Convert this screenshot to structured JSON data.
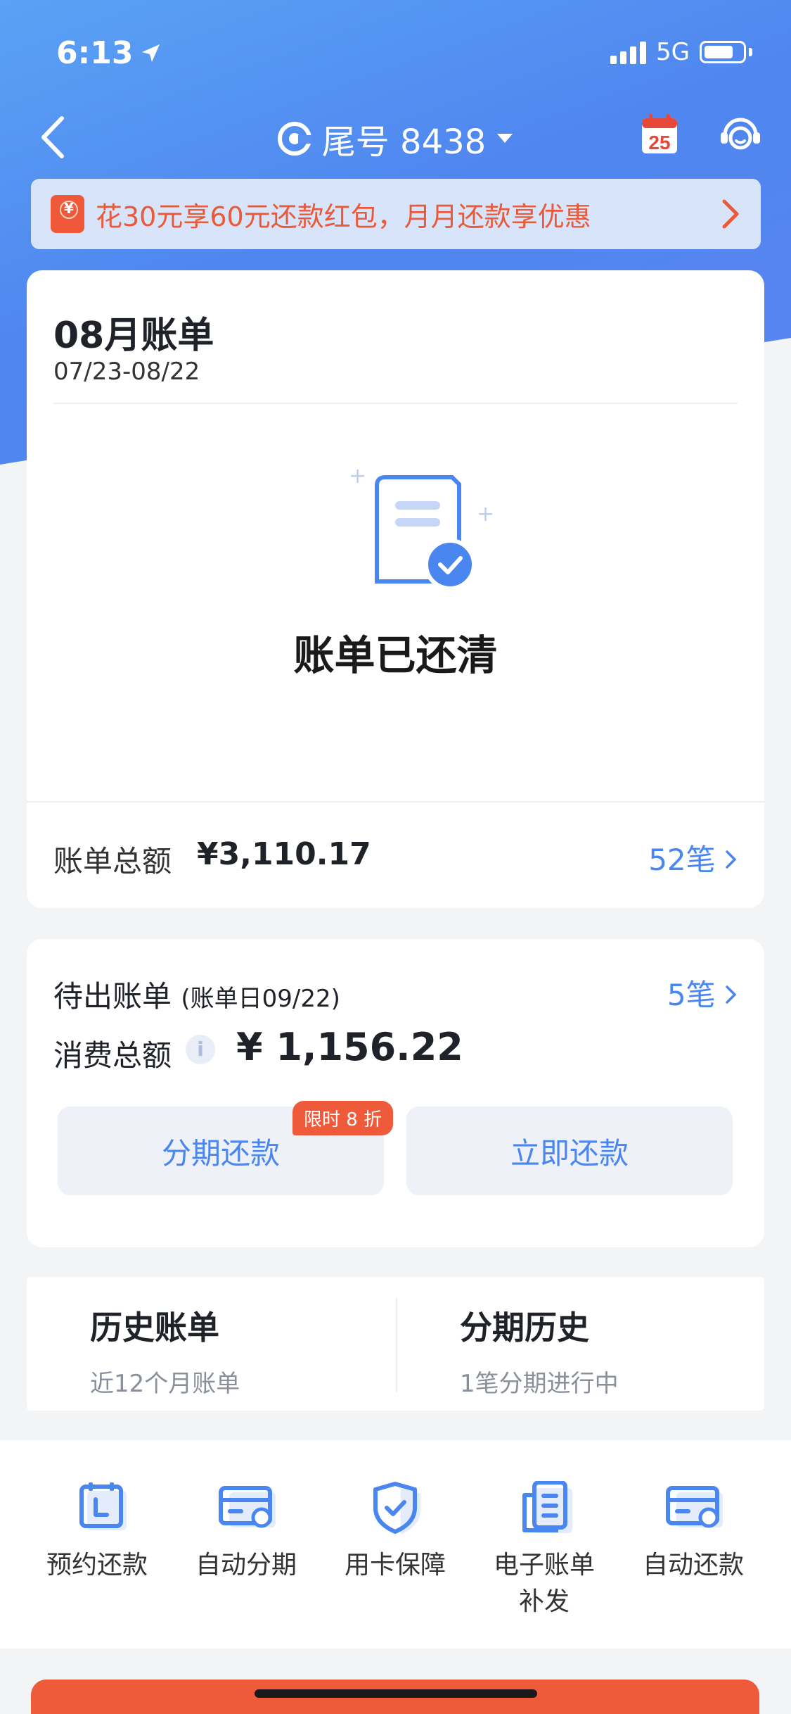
{
  "colors": {
    "accent": "#4a86f0",
    "promo": "#ea5a3a",
    "hero": "#4f86ef",
    "tag": "#ee5a3a"
  },
  "status_bar": {
    "time": "6:13",
    "network": "5G"
  },
  "nav": {
    "account_label": "尾号 8438",
    "calendar_day": "25",
    "icons": [
      "back-icon",
      "bank-logo-icon",
      "calendar-icon",
      "customer-service-icon"
    ]
  },
  "promo": {
    "text": "花30元享60元还款红包，月月还款享优惠"
  },
  "bill": {
    "title": "08月账单",
    "range": "07/23-08/22",
    "status": "账单已还清",
    "total_label": "账单总额",
    "total_value": "¥3,110.17",
    "count": "52笔"
  },
  "pending": {
    "title": "待出账单",
    "bill_day": "(账单日09/22)",
    "count": "5笔",
    "spend_label": "消费总额",
    "spend_value": "¥ 1,156.22",
    "installment_button": "分期还款",
    "installment_tag": "限时 8 折",
    "repay_button": "立即还款"
  },
  "history": {
    "bills_title": "历史账单",
    "bills_sub": "近12个月账单",
    "installment_title": "分期历史",
    "installment_sub": "1笔分期进行中"
  },
  "tools": [
    {
      "label": "预约还款",
      "icon": "scheduled-repay-icon"
    },
    {
      "label": "自动分期",
      "icon": "auto-installment-icon"
    },
    {
      "label": "用卡保障",
      "icon": "card-protection-icon"
    },
    {
      "label": "电子账单\n补发",
      "icon": "e-bill-icon"
    },
    {
      "label": "自动还款",
      "icon": "auto-repay-icon"
    }
  ]
}
